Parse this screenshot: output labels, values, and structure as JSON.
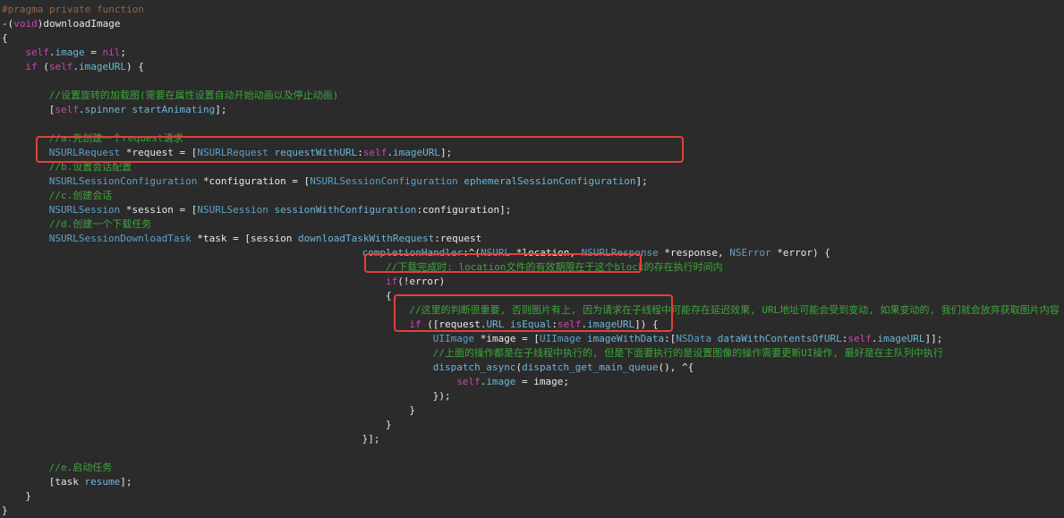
{
  "colors": {
    "background": "#2b2b2b",
    "plain": "#e8e8e8",
    "keyword": "#c848b0",
    "preprocessor": "#9a6340",
    "type": "#5fa0c8",
    "method": "#6cb6d8",
    "comment": "#3da63a",
    "highlight": "#e0413a"
  },
  "code": [
    {
      "indent": 0,
      "tokens": [
        [
          "pp",
          "#pragma private function"
        ]
      ]
    },
    {
      "indent": 0,
      "tokens": [
        [
          "pl",
          "-("
        ],
        [
          "kw",
          "void"
        ],
        [
          "pl",
          ")downloadImage"
        ]
      ]
    },
    {
      "indent": 0,
      "tokens": [
        [
          "pl",
          "{"
        ]
      ]
    },
    {
      "indent": 4,
      "tokens": [
        [
          "kw",
          "self"
        ],
        [
          "pl",
          "."
        ],
        [
          "me",
          "image"
        ],
        [
          "pl",
          " = "
        ],
        [
          "kw",
          "nil"
        ],
        [
          "pl",
          ";"
        ]
      ]
    },
    {
      "indent": 4,
      "tokens": [
        [
          "kw",
          "if"
        ],
        [
          "pl",
          " ("
        ],
        [
          "kw",
          "self"
        ],
        [
          "pl",
          "."
        ],
        [
          "me",
          "imageURL"
        ],
        [
          "pl",
          ") {"
        ]
      ]
    },
    {
      "indent": 0,
      "tokens": []
    },
    {
      "indent": 8,
      "tokens": [
        [
          "cm",
          "//设置旋转的加载图(需要在属性设置自动开始动画以及停止动画)"
        ]
      ]
    },
    {
      "indent": 8,
      "tokens": [
        [
          "pl",
          "["
        ],
        [
          "kw",
          "self"
        ],
        [
          "pl",
          "."
        ],
        [
          "me",
          "spinner"
        ],
        [
          "pl",
          " "
        ],
        [
          "me",
          "startAnimating"
        ],
        [
          "pl",
          "];"
        ]
      ]
    },
    {
      "indent": 0,
      "tokens": []
    },
    {
      "indent": 8,
      "tokens": [
        [
          "cm",
          "//a.先创建一个request请求"
        ]
      ]
    },
    {
      "indent": 8,
      "tokens": [
        [
          "ty",
          "NSURLRequest"
        ],
        [
          "pl",
          " *request = ["
        ],
        [
          "ty",
          "NSURLRequest"
        ],
        [
          "pl",
          " "
        ],
        [
          "me",
          "requestWithURL"
        ],
        [
          "pl",
          ":"
        ],
        [
          "kw",
          "self"
        ],
        [
          "pl",
          "."
        ],
        [
          "me",
          "imageURL"
        ],
        [
          "pl",
          "];"
        ]
      ]
    },
    {
      "indent": 8,
      "tokens": [
        [
          "cm",
          "//b.设置会话配置"
        ]
      ]
    },
    {
      "indent": 8,
      "tokens": [
        [
          "ty",
          "NSURLSessionConfiguration"
        ],
        [
          "pl",
          " *configuration = ["
        ],
        [
          "ty",
          "NSURLSessionConfiguration"
        ],
        [
          "pl",
          " "
        ],
        [
          "me",
          "ephemeralSessionConfiguration"
        ],
        [
          "pl",
          "];"
        ]
      ]
    },
    {
      "indent": 8,
      "tokens": [
        [
          "cm",
          "//c.创建会话"
        ]
      ]
    },
    {
      "indent": 8,
      "tokens": [
        [
          "ty",
          "NSURLSession"
        ],
        [
          "pl",
          " *session = ["
        ],
        [
          "ty",
          "NSURLSession"
        ],
        [
          "pl",
          " "
        ],
        [
          "me",
          "sessionWithConfiguration"
        ],
        [
          "pl",
          ":configuration];"
        ]
      ]
    },
    {
      "indent": 8,
      "tokens": [
        [
          "cm",
          "//d.创建一个下载任务"
        ]
      ]
    },
    {
      "indent": 8,
      "tokens": [
        [
          "ty",
          "NSURLSessionDownloadTask"
        ],
        [
          "pl",
          " *task = [session "
        ],
        [
          "me",
          "downloadTaskWithRequest"
        ],
        [
          "pl",
          ":request"
        ]
      ]
    },
    {
      "indent": 61,
      "tokens": [
        [
          "me",
          "completionHandler"
        ],
        [
          "pl",
          ":^("
        ],
        [
          "ty",
          "NSURL"
        ],
        [
          "pl",
          " *location, "
        ],
        [
          "ty",
          "NSURLResponse"
        ],
        [
          "pl",
          " *response, "
        ],
        [
          "ty",
          "NSError"
        ],
        [
          "pl",
          " *error) {"
        ]
      ]
    },
    {
      "indent": 65,
      "tokens": [
        [
          "cm",
          "//下载完成时: location文件的有效期限在于这个block的存在执行时间内"
        ]
      ]
    },
    {
      "indent": 65,
      "tokens": [
        [
          "kw",
          "if"
        ],
        [
          "pl",
          "(!error)"
        ]
      ]
    },
    {
      "indent": 65,
      "tokens": [
        [
          "pl",
          "{"
        ]
      ]
    },
    {
      "indent": 69,
      "tokens": [
        [
          "cm",
          "//这里的判断很重要, 否则图片有上, 因为请求在子线程中可能存在延迟效果, URL地址可能会受到变动, 如果变动的, 我们就会放弃获取图片内容"
        ]
      ]
    },
    {
      "indent": 69,
      "tokens": [
        [
          "kw",
          "if"
        ],
        [
          "pl",
          " (["
        ],
        [
          "pl",
          "request"
        ],
        [
          "pl",
          "."
        ],
        [
          "me",
          "URL"
        ],
        [
          "pl",
          " "
        ],
        [
          "me",
          "isEqual"
        ],
        [
          "pl",
          ":"
        ],
        [
          "kw",
          "self"
        ],
        [
          "pl",
          "."
        ],
        [
          "me",
          "imageURL"
        ],
        [
          "pl",
          "]) {"
        ]
      ]
    },
    {
      "indent": 73,
      "tokens": [
        [
          "ty",
          "UIImage"
        ],
        [
          "pl",
          " *image = ["
        ],
        [
          "ty",
          "UIImage"
        ],
        [
          "pl",
          " "
        ],
        [
          "me",
          "imageWithData"
        ],
        [
          "pl",
          ":["
        ],
        [
          "ty",
          "NSData"
        ],
        [
          "pl",
          " "
        ],
        [
          "me",
          "dataWithContentsOfURL"
        ],
        [
          "pl",
          ":"
        ],
        [
          "kw",
          "self"
        ],
        [
          "pl",
          "."
        ],
        [
          "me",
          "imageURL"
        ],
        [
          "pl",
          "]];"
        ]
      ]
    },
    {
      "indent": 73,
      "tokens": [
        [
          "cm",
          "//上面的操作都是在子线程中执行的, 但是下面要执行的是设置图像的操作需要更新UI操作, 最好是在主队列中执行"
        ]
      ]
    },
    {
      "indent": 73,
      "tokens": [
        [
          "me",
          "dispatch_async"
        ],
        [
          "pl",
          "("
        ],
        [
          "me",
          "dispatch_get_main_queue"
        ],
        [
          "pl",
          "(), ^{"
        ]
      ]
    },
    {
      "indent": 77,
      "tokens": [
        [
          "kw",
          "self"
        ],
        [
          "pl",
          "."
        ],
        [
          "me",
          "image"
        ],
        [
          "pl",
          " = image;"
        ]
      ]
    },
    {
      "indent": 73,
      "tokens": [
        [
          "pl",
          "});"
        ]
      ]
    },
    {
      "indent": 69,
      "tokens": [
        [
          "pl",
          "}"
        ]
      ]
    },
    {
      "indent": 65,
      "tokens": [
        [
          "pl",
          "}"
        ]
      ]
    },
    {
      "indent": 61,
      "tokens": [
        [
          "pl",
          "}];"
        ]
      ]
    },
    {
      "indent": 0,
      "tokens": []
    },
    {
      "indent": 8,
      "tokens": [
        [
          "cm",
          "//e.启动任务"
        ]
      ]
    },
    {
      "indent": 8,
      "tokens": [
        [
          "pl",
          "[task "
        ],
        [
          "me",
          "resume"
        ],
        [
          "pl",
          "];"
        ]
      ]
    },
    {
      "indent": 4,
      "tokens": [
        [
          "pl",
          "}"
        ]
      ]
    },
    {
      "indent": 0,
      "tokens": [
        [
          "pl",
          "}"
        ]
      ]
    }
  ],
  "highlights": [
    {
      "name": "highlight-configuration-line",
      "line": 12
    },
    {
      "name": "highlight-url-check",
      "line": 22
    },
    {
      "name": "highlight-dispatch-block",
      "line": 25
    }
  ]
}
